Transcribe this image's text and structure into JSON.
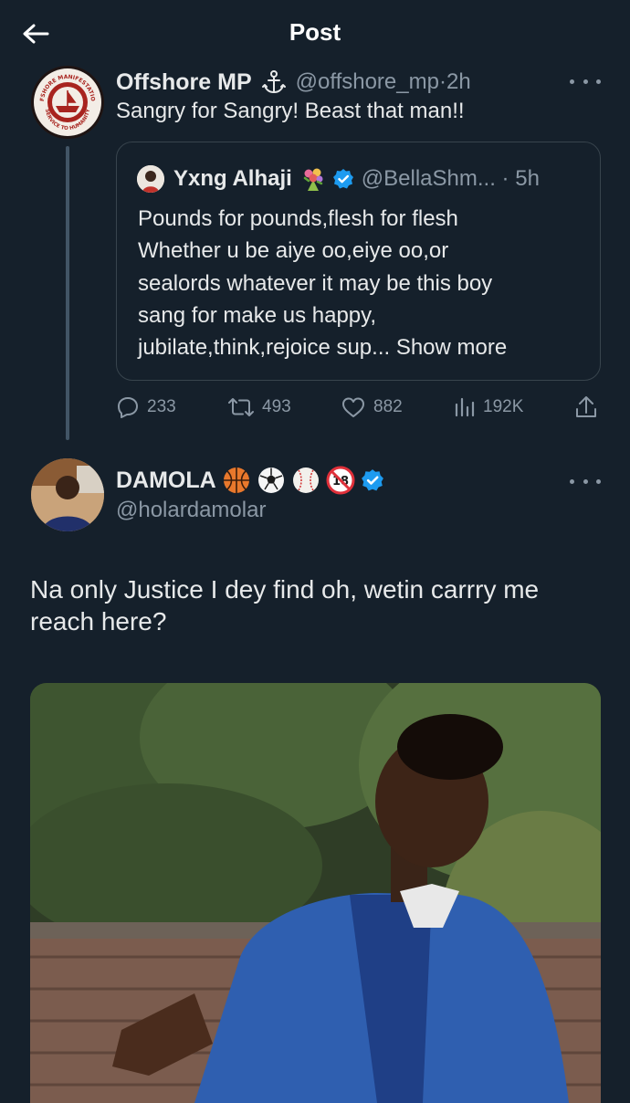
{
  "header": {
    "title": "Post"
  },
  "quoted_thread_post": {
    "author_name": "Offshore MP",
    "author_handle": "@offshore_mp",
    "time": "2h",
    "avatar_text_top": "OFFSHORE MANIFESTATIONS",
    "avatar_text_bottom": "SERVICE TO HUMANITY",
    "text": "Sangry for Sangry! Beast that man!!",
    "quote": {
      "author_name": "Yxng Alhaji",
      "author_handle": "@BellaShm...",
      "time": "5h",
      "lines": [
        "Pounds for pounds,flesh for flesh",
        "Whether u be aiye oo,eiye oo,or",
        "sealords whatever it may be this boy",
        "sang for make us happy,",
        "jubilate,think,rejoice sup..."
      ],
      "show_more": "Show more"
    },
    "stats": {
      "replies": "233",
      "reposts": "493",
      "likes": "882",
      "views": "192K"
    }
  },
  "main_post": {
    "author_name": "DAMOLA",
    "author_handle": "@holardamolar",
    "text": "Na only Justice I dey find oh, wetin carrry me reach here?"
  },
  "icons": {
    "back": "arrow-left-icon",
    "anchor": "anchor-icon",
    "more": "more-horizontal-icon",
    "verified": "verified-badge-icon",
    "reply": "reply-icon",
    "repost": "repost-icon",
    "like": "heart-icon",
    "views": "views-icon",
    "share": "share-icon",
    "bouquet": "bouquet-emoji",
    "basketball": "basketball-emoji",
    "soccer": "soccer-ball-emoji",
    "baseball": "baseball-emoji",
    "no_under_18": "no-one-under-eighteen-emoji"
  },
  "colors": {
    "background": "#15202b",
    "text": "#e7e9ea",
    "secondary": "#8b98a5",
    "verified": "#1d9bf0",
    "border": "#38444d"
  }
}
